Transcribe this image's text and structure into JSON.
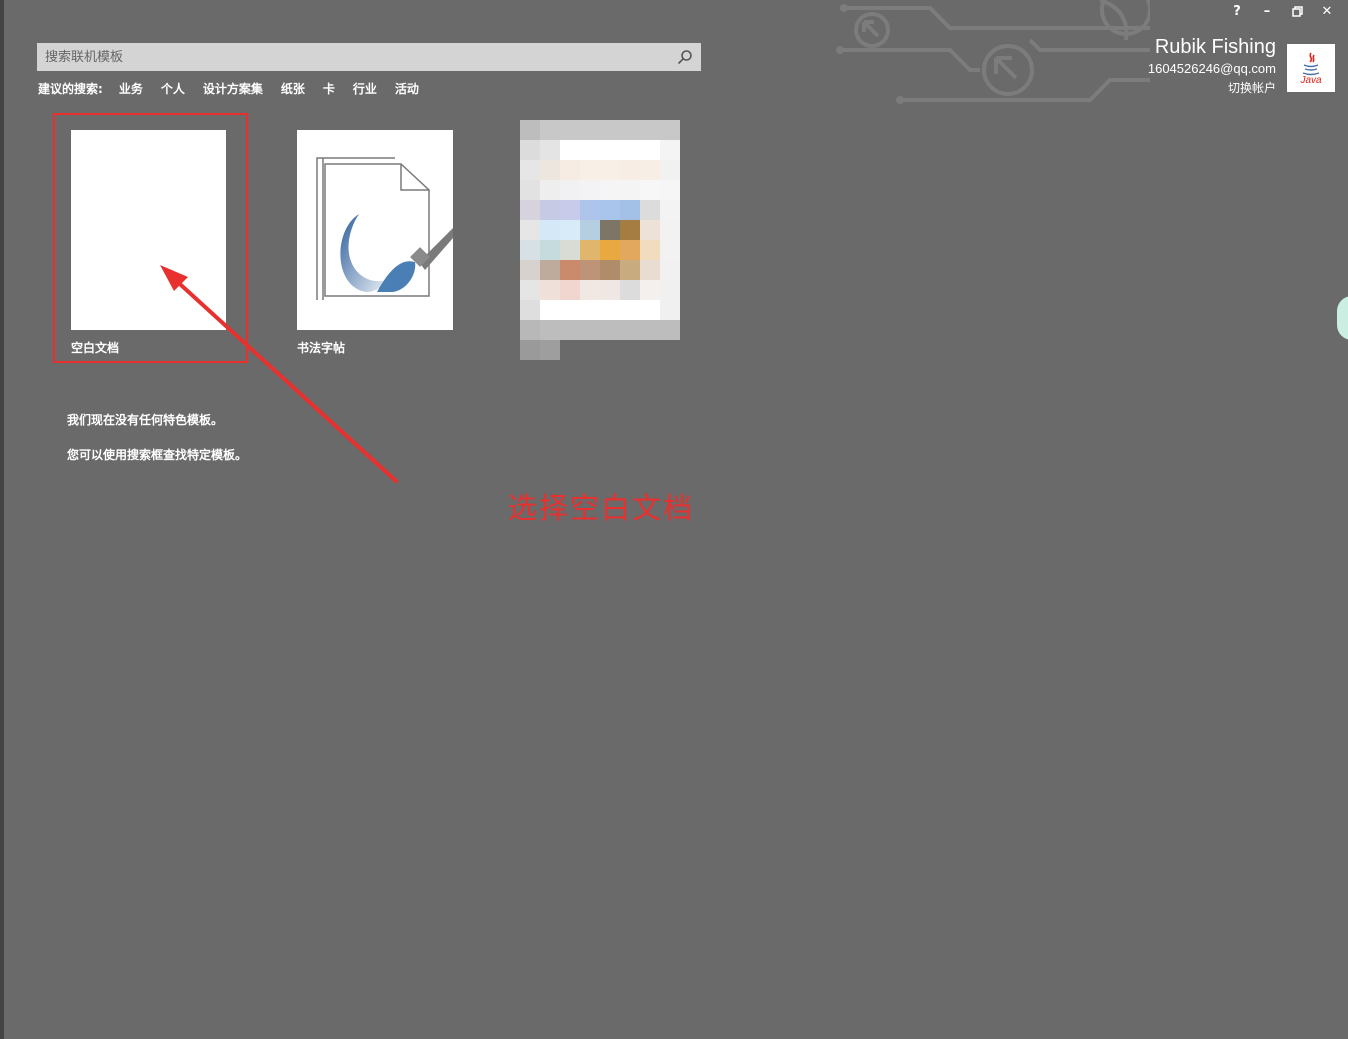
{
  "window_controls": {
    "help": "?",
    "minimize": "–",
    "restore": "🗗",
    "close": "✕"
  },
  "account": {
    "name": "Rubik Fishing",
    "email": "1604526246@qq.com",
    "switch_label": "切换帐户",
    "avatar_label": "Java"
  },
  "search": {
    "placeholder": "搜索联机模板"
  },
  "suggested": {
    "title": "建议的搜索:",
    "items": [
      "业务",
      "个人",
      "设计方案集",
      "纸张",
      "卡",
      "行业",
      "活动"
    ]
  },
  "templates": [
    {
      "label": "空白文档"
    },
    {
      "label": "书法字帖"
    },
    {
      "label": ""
    }
  ],
  "messages": {
    "line1": "我们现在没有任何特色模板。",
    "line2": "您可以使用搜索框查找特定模板。"
  },
  "annotation": {
    "text": "选择空白文档",
    "color": "#e8302f"
  },
  "colors": {
    "background": "#6a6a6a",
    "search_bg": "#d4d4d4",
    "accent_brush": "#4a7fb5"
  }
}
